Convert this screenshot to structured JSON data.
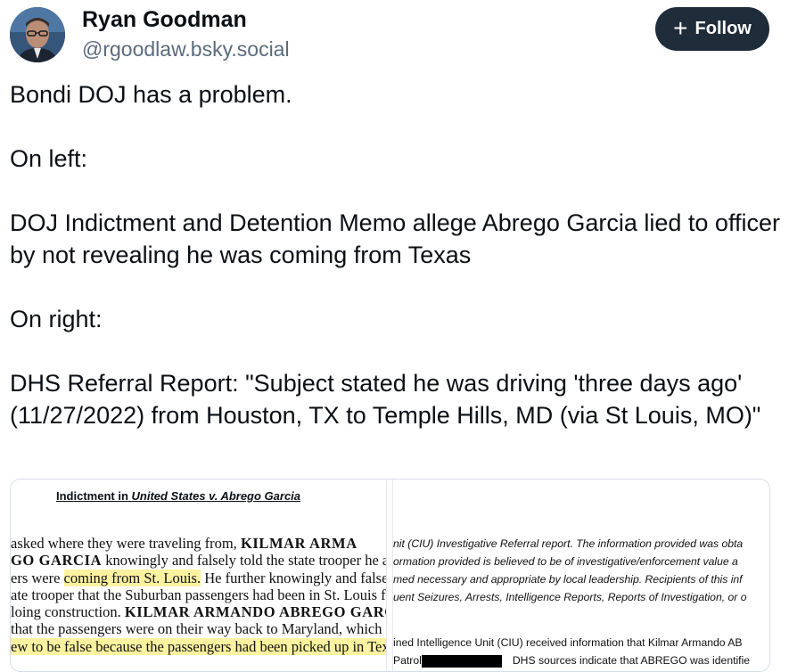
{
  "header": {
    "name": "Ryan Goodman",
    "handle": "@rgoodlaw.bsky.social",
    "follow_label": "Follow"
  },
  "post": {
    "paragraphs": [
      "Bondi DOJ has a problem.",
      "On left:",
      "DOJ Indictment and Detention Memo allege Abrego Garcia lied to officer by not revealing he was coming from Texas",
      "On right:",
      "DHS Referral Report: \"Subject stated he was driving 'three days ago' (11/27/2022) from Houston, TX to Temple Hills, MD (via St Louis, MO)\""
    ]
  },
  "media": {
    "left": {
      "title_prefix": "Indictment in ",
      "title_italic": "United States v. Abrego Garcia",
      "lines": [
        {
          "a": "asked  where  they  were  traveling  from,  ",
          "b": "KILMAR  ARMA",
          "c": ""
        },
        {
          "a": "",
          "b": "GO GARCIA",
          "c": " knowingly and falsely told the state trooper he a"
        },
        {
          "a": "ers were ",
          "hl": "coming from St. Louis.",
          "c": " He further knowingly and falsely"
        },
        {
          "a": "ate trooper that the Suburban passengers had been in St. Louis f",
          "b": "",
          "c": ""
        },
        {
          "a": "loing construction. ",
          "b": "KILMAR ARMANDO ABREGO GARCI",
          "c": ""
        },
        {
          "a": "that the passengers were on their way back to Maryland, which",
          "b": "",
          "c": ""
        },
        {
          "full_hl": "ew to be false because the passengers had been picked up in Texa"
        }
      ]
    },
    "right": {
      "italic_lines": [
        "nit (CIU) Investigative Referral report. The information provided was obta",
        "ormation provided is believed to be of investigative/enforcement value a",
        "med necessary and appropriate by local leadership. Recipients of this inf",
        "uent Seizures, Arrests, Intelligence Reports, Reports of Investigation, or o"
      ],
      "plain_lines": [
        "ined Intelligence Unit (CIU) received information that Kilmar Armando AB",
        "Patrol",
        "DHS sources indicate that ABREGO was identifie"
      ]
    }
  }
}
